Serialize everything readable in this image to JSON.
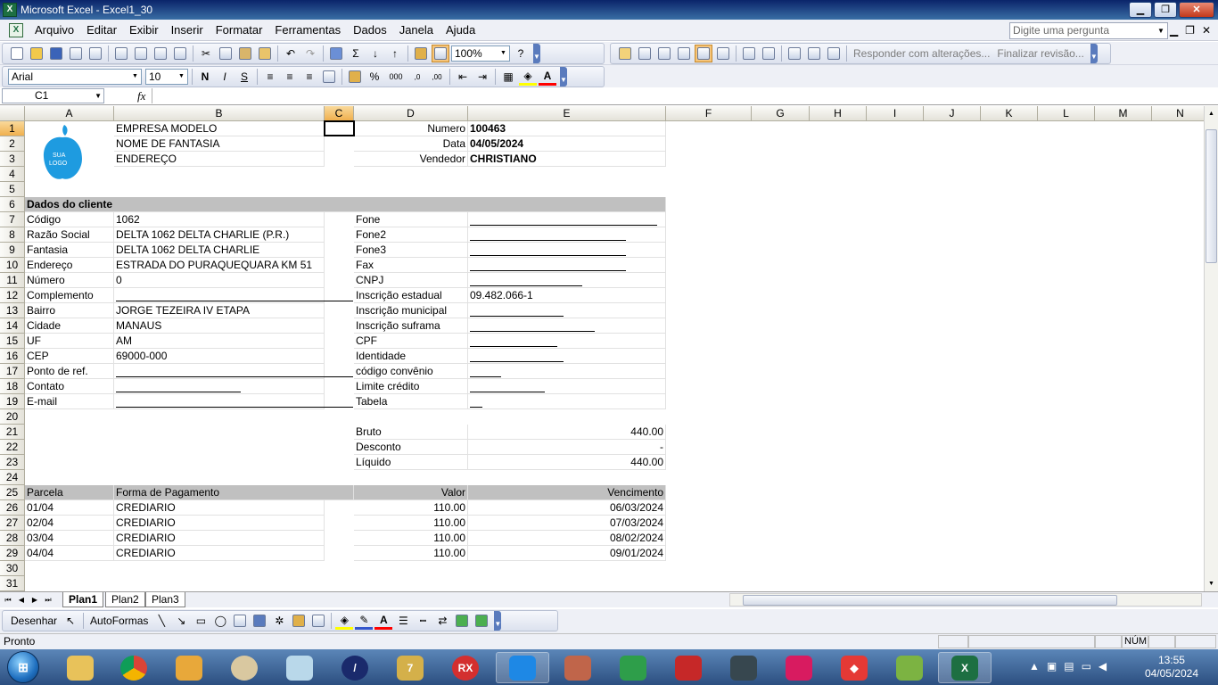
{
  "window": {
    "title": "Microsoft Excel - Excel1_30",
    "minimize": "▁",
    "maximize": "❐",
    "close": "✕"
  },
  "menu": {
    "items": [
      "Arquivo",
      "Editar",
      "Exibir",
      "Inserir",
      "Formatar",
      "Ferramentas",
      "Dados",
      "Janela",
      "Ajuda"
    ],
    "help_placeholder": "Digite uma pergunta",
    "doc_min": "▁",
    "doc_restore": "❐",
    "doc_close": "✕"
  },
  "toolbar": {
    "zoom": "100%",
    "sum": "Σ",
    "reply": "Responder com alterações...",
    "end_review": "Finalizar revisão..."
  },
  "format": {
    "font": "Arial",
    "size": "10",
    "bold": "N",
    "italic": "I",
    "underline": "S",
    "percent": "%",
    "thousands": "000",
    "inc_dec": ",0 ,00",
    "dec_dec": ",00 ,0"
  },
  "formula": {
    "namebox": "C1",
    "fx": "fx",
    "content": ""
  },
  "columns": [
    "A",
    "B",
    "C",
    "D",
    "E",
    "F",
    "G",
    "H",
    "I",
    "J",
    "K",
    "L",
    "M",
    "N"
  ],
  "rows": [
    "1",
    "2",
    "3",
    "4",
    "5",
    "6",
    "7",
    "8",
    "9",
    "10",
    "11",
    "12",
    "13",
    "14",
    "15",
    "16",
    "17",
    "18",
    "19",
    "20",
    "21",
    "22",
    "23",
    "24",
    "25",
    "26",
    "27",
    "28",
    "29",
    "30",
    "31"
  ],
  "logo": {
    "line1": "SUA",
    "line2": "LOGO"
  },
  "header": {
    "company": "EMPRESA MODELO",
    "fantasy": "NOME DE FANTASIA",
    "address": "ENDEREÇO",
    "numero_label": "Numero",
    "numero": "100463",
    "data_label": "Data",
    "data": "04/05/2024",
    "vendedor_label": "Vendedor",
    "vendedor": "CHRISTIANO"
  },
  "client": {
    "section": "Dados do cliente",
    "left": [
      {
        "label": "Código",
        "value": "1062"
      },
      {
        "label": "Razão Social",
        "value": "DELTA 1062 DELTA CHARLIE (P.R.)"
      },
      {
        "label": "Fantasia",
        "value": "DELTA 1062 DELTA CHARLIE"
      },
      {
        "label": "Endereço",
        "value": "ESTRADA DO PURAQUEQUARA KM 51"
      },
      {
        "label": "Número",
        "value": "0"
      },
      {
        "label": "Complemento",
        "value": ""
      },
      {
        "label": "Bairro",
        "value": "JORGE TEZEIRA IV ETAPA"
      },
      {
        "label": "Cidade",
        "value": "MANAUS"
      },
      {
        "label": "UF",
        "value": "AM"
      },
      {
        "label": "CEP",
        "value": "69000-000"
      },
      {
        "label": "Ponto de ref.",
        "value": ""
      },
      {
        "label": "Contato",
        "value": ""
      },
      {
        "label": "E-mail",
        "value": ""
      }
    ],
    "right": [
      {
        "label": "Fone",
        "value": ""
      },
      {
        "label": "Fone2",
        "value": ""
      },
      {
        "label": "Fone3",
        "value": ""
      },
      {
        "label": "Fax",
        "value": ""
      },
      {
        "label": "CNPJ",
        "value": ""
      },
      {
        "label": "Inscrição estadual",
        "value": "09.482.066-1"
      },
      {
        "label": "Inscrição municipal",
        "value": ""
      },
      {
        "label": "Inscrição suframa",
        "value": ""
      },
      {
        "label": "CPF",
        "value": ""
      },
      {
        "label": "Identidade",
        "value": ""
      },
      {
        "label": "código convênio",
        "value": ""
      },
      {
        "label": "Limite crédito",
        "value": ""
      },
      {
        "label": "Tabela",
        "value": ""
      }
    ]
  },
  "totals": [
    {
      "label": "Bruto",
      "value": "440.00"
    },
    {
      "label": "Desconto",
      "value": "-"
    },
    {
      "label": "Líquido",
      "value": "440.00"
    }
  ],
  "payments": {
    "headers": [
      "Parcela",
      "Forma de Pagamento",
      "Valor",
      "Vencimento"
    ],
    "rows": [
      [
        "01/04",
        "CREDIARIO",
        "110.00",
        "06/03/2024"
      ],
      [
        "02/04",
        "CREDIARIO",
        "110.00",
        "07/03/2024"
      ],
      [
        "03/04",
        "CREDIARIO",
        "110.00",
        "08/02/2024"
      ],
      [
        "04/04",
        "CREDIARIO",
        "110.00",
        "09/01/2024"
      ]
    ]
  },
  "sheets": [
    "Plan1",
    "Plan2",
    "Plan3"
  ],
  "drawing": {
    "draw": "Desenhar",
    "autoshapes": "AutoFormas"
  },
  "status": {
    "text": "Pronto",
    "num": "NÚM"
  },
  "taskbar": {
    "time": "13:55",
    "date": "04/05/2024",
    "rx_label": "RX"
  }
}
